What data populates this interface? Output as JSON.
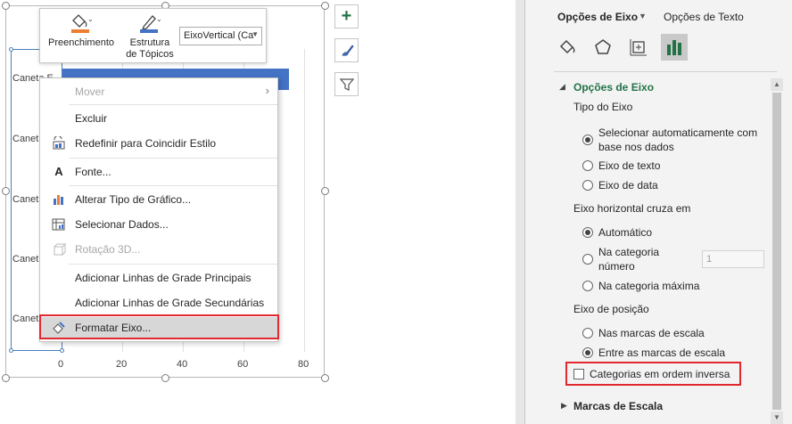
{
  "chart": {
    "categories": [
      "Caneta E",
      "Caneta",
      "Caneta",
      "Caneta",
      "Caneta"
    ],
    "x_ticks": [
      "0",
      "20",
      "40",
      "60",
      "80"
    ]
  },
  "mini_toolbar": {
    "fill_label": "Preenchimento",
    "outline_label_1": "Estrutura",
    "outline_label_2": "de Tópicos",
    "element_select": "EixoVertical (Ca"
  },
  "context_menu": {
    "move": "Mover",
    "delete": "Excluir",
    "reset_style": "Redefinir para Coincidir Estilo",
    "font": "Fonte...",
    "change_chart_type": "Alterar Tipo de Gráfico...",
    "select_data": "Selecionar Dados...",
    "rotation_3d": "Rotação 3D...",
    "add_major_gridlines": "Adicionar Linhas de Grade Principais",
    "add_minor_gridlines": "Adicionar Linhas de Grade Secundárias",
    "format_axis": "Formatar Eixo..."
  },
  "pane": {
    "tab_axis_options": "Opções de Eixo",
    "tab_text_options": "Opções de Texto",
    "section_title": "Opções de Eixo",
    "axis_type_label": "Tipo do Eixo",
    "auto_select_1": "Selecionar automaticamente com",
    "auto_select_2": "base nos dados",
    "text_axis": "Eixo de texto",
    "date_axis": "Eixo de data",
    "horizontal_crosses_label": "Eixo horizontal cruza em",
    "automatic": "Automático",
    "at_category_1": "Na categoria",
    "at_category_2": "número",
    "category_number_value": "1",
    "at_max_category": "Na categoria máxima",
    "axis_position_label": "Eixo de posição",
    "on_tick_marks": "Nas marcas de escala",
    "between_tick_marks": "Entre as marcas de escala",
    "reverse_order": "Categorias em ordem inversa",
    "tick_marks_section": "Marcas de Escala"
  },
  "colors": {
    "accent_green": "#217346",
    "highlight_red": "#e0282e",
    "bar_blue": "#4472c4"
  }
}
